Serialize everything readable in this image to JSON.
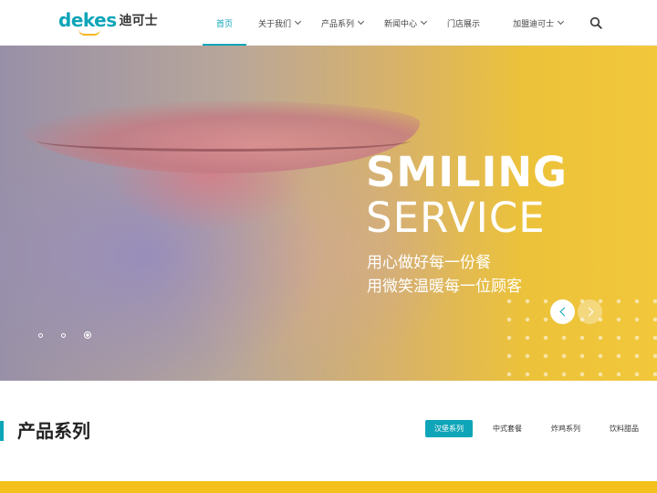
{
  "header": {
    "logo_en": "dekes",
    "logo_cn": "迪可士",
    "nav": [
      {
        "label": "首页",
        "active": true,
        "dropdown": false
      },
      {
        "label": "关于我们",
        "active": false,
        "dropdown": true
      },
      {
        "label": "产品系列",
        "active": false,
        "dropdown": true
      },
      {
        "label": "新闻中心",
        "active": false,
        "dropdown": true
      },
      {
        "label": "门店展示",
        "active": false,
        "dropdown": false
      },
      {
        "label": "加盟迪可士",
        "active": false,
        "dropdown": true
      }
    ],
    "search_icon": "search-icon"
  },
  "banner": {
    "title_line1": "SMILING",
    "title_line2": "SERVICE",
    "subtitle_line1": "用心做好每一份餐",
    "subtitle_line2": "用微笑温暖每一位顾客",
    "slide_count": 3,
    "active_slide": 3
  },
  "products": {
    "title": "产品系列",
    "tabs": [
      {
        "label": "汉堡系列",
        "active": true
      },
      {
        "label": "中式套餐",
        "active": false
      },
      {
        "label": "炸鸡系列",
        "active": false
      },
      {
        "label": "饮料甜品",
        "active": false
      }
    ]
  },
  "colors": {
    "accent": "#0fa5b8",
    "brand_yellow": "#f3b61f"
  }
}
